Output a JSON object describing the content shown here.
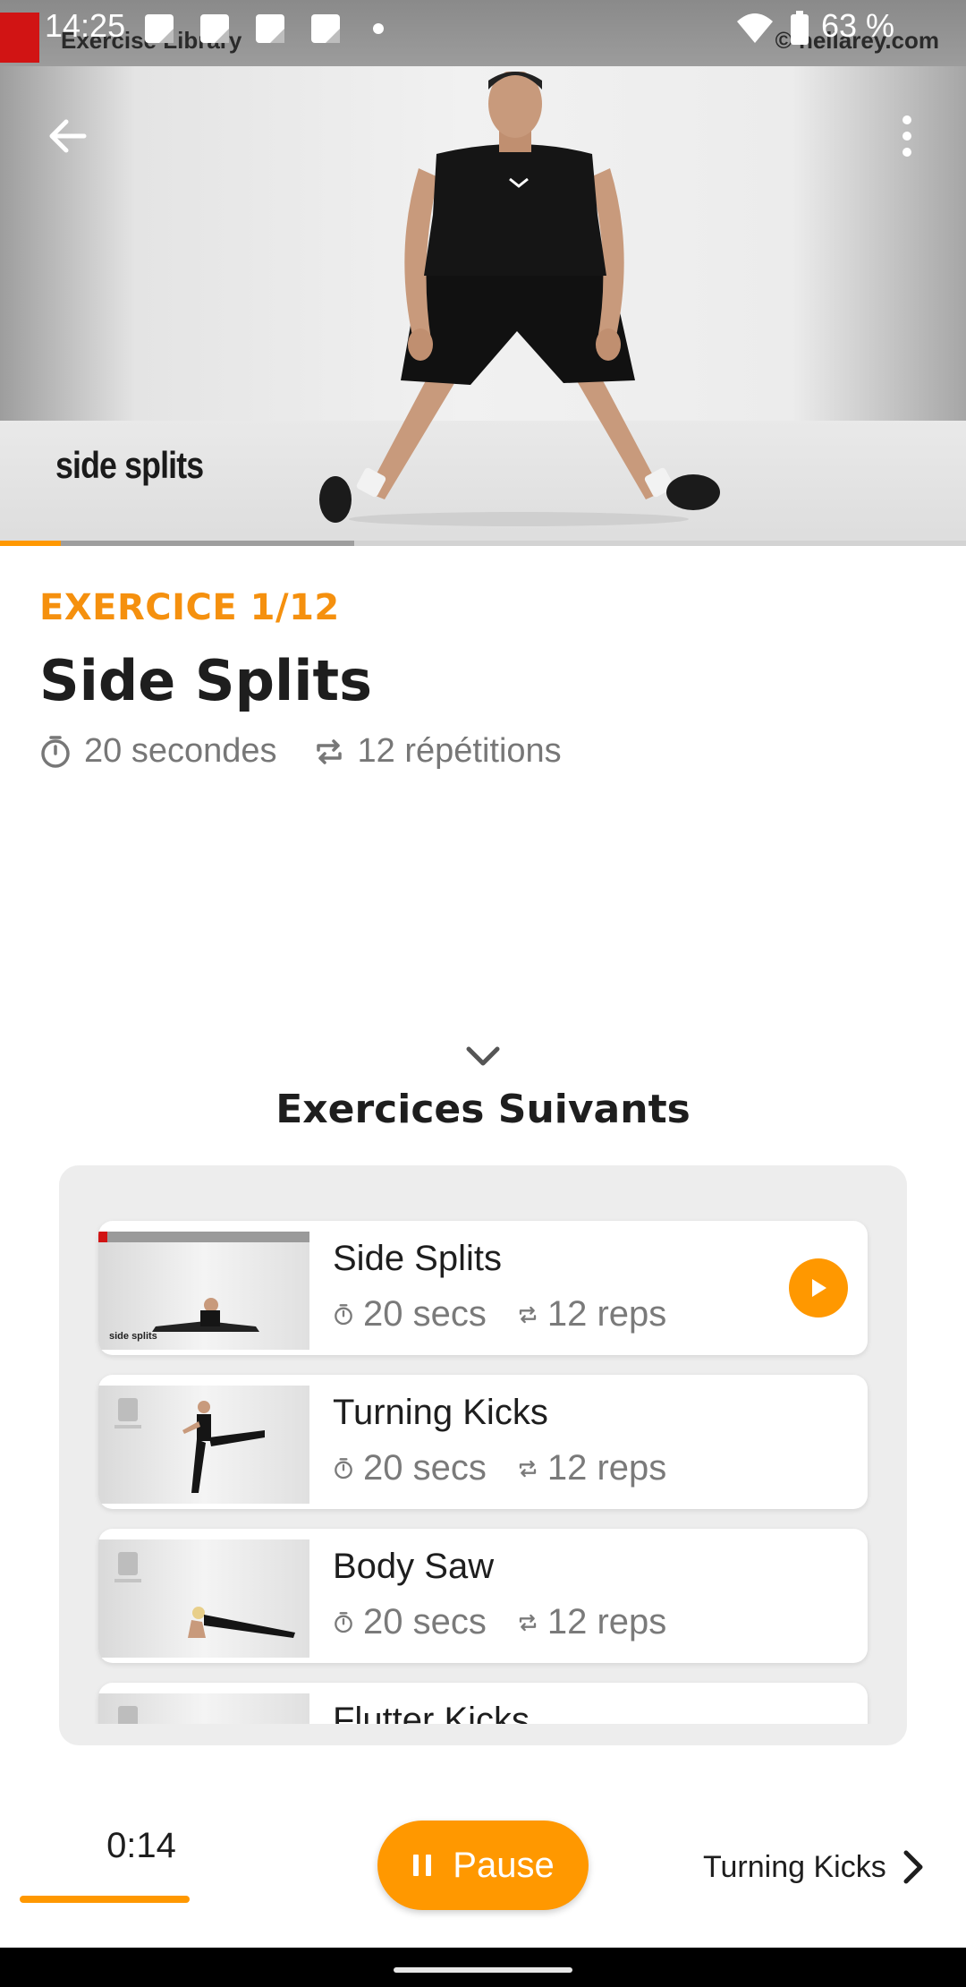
{
  "status_bar": {
    "time": "14:25",
    "battery_percent": "63 %",
    "notification_icons": [
      "notification-icon",
      "notification-icon",
      "notification-icon",
      "notification-icon"
    ]
  },
  "video": {
    "header_left_text": "Exercise Library",
    "header_right_text": "© nellarey.com",
    "caption": "side splits",
    "progress_fraction": 0.063,
    "buffered_fraction": 0.367
  },
  "exercise": {
    "counter": "EXERCICE 1/12",
    "title": "Side Splits",
    "duration": "20 secondes",
    "repetitions": "12 répétitions"
  },
  "next_section": {
    "heading": "Exercices Suivants",
    "items": [
      {
        "name": "Side Splits",
        "duration": "20 secs",
        "reps": "12 reps",
        "playing": true
      },
      {
        "name": "Turning Kicks",
        "duration": "20 secs",
        "reps": "12 reps",
        "playing": false
      },
      {
        "name": "Body Saw",
        "duration": "20 secs",
        "reps": "12 reps",
        "playing": false
      },
      {
        "name": "Flutter Kicks",
        "duration": "",
        "reps": "",
        "playing": false
      }
    ]
  },
  "bottom_bar": {
    "timer": "0:14",
    "pause_label": "Pause",
    "next_label": "Turning Kicks"
  },
  "colors": {
    "accent": "#ff9800",
    "counter_text": "#f5900e",
    "text_dark": "#1e1e1e",
    "text_muted": "#777777",
    "card_bg": "#ededed"
  },
  "icons": {
    "back": "arrow-left-icon",
    "more": "more-vert-icon",
    "timer": "stopwatch-icon",
    "repeat": "repeat-icon",
    "chevron": "chevron-down-icon",
    "play": "play-icon",
    "pause": "pause-icon",
    "next": "chevron-right-icon"
  }
}
